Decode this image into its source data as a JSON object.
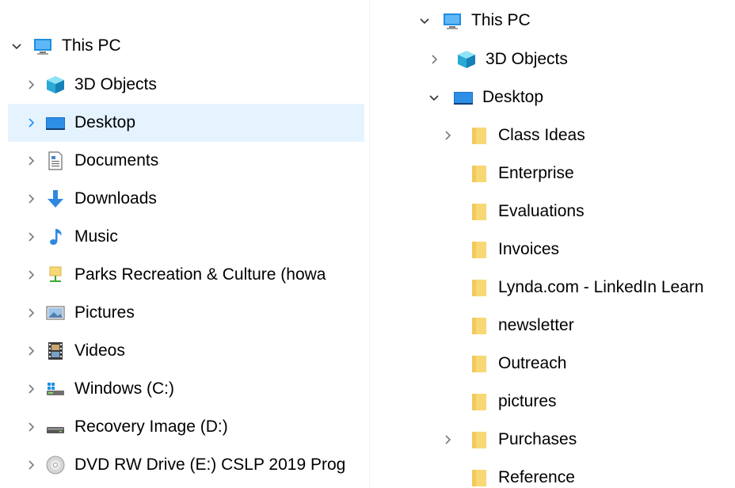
{
  "left_pane": {
    "items": [
      {
        "label": "This PC",
        "icon": "monitor-icon",
        "expander": "expanded",
        "selected": false
      },
      {
        "label": "3D Objects",
        "icon": "cube-3d-icon",
        "expander": "collapsed",
        "selected": false
      },
      {
        "label": "Desktop",
        "icon": "desktop-icon",
        "expander": "collapsed",
        "selected": true
      },
      {
        "label": "Documents",
        "icon": "document-icon",
        "expander": "collapsed",
        "selected": false
      },
      {
        "label": "Downloads",
        "icon": "download-arrow-icon",
        "expander": "collapsed",
        "selected": false
      },
      {
        "label": "Music",
        "icon": "music-note-icon",
        "expander": "collapsed",
        "selected": false
      },
      {
        "label": "Parks Recreation & Culture (howa",
        "icon": "network-drive-icon",
        "expander": "collapsed",
        "selected": false
      },
      {
        "label": "Pictures",
        "icon": "pictures-icon",
        "expander": "collapsed",
        "selected": false
      },
      {
        "label": "Videos",
        "icon": "film-strip-icon",
        "expander": "collapsed",
        "selected": false
      },
      {
        "label": "Windows (C:)",
        "icon": "windows-drive-icon",
        "expander": "collapsed",
        "selected": false
      },
      {
        "label": "Recovery Image (D:)",
        "icon": "hard-drive-icon",
        "expander": "collapsed",
        "selected": false
      },
      {
        "label": "DVD RW Drive (E:) CSLP 2019 Prog",
        "icon": "dvd-disc-icon",
        "expander": "collapsed",
        "selected": false
      }
    ]
  },
  "right_pane": {
    "items": [
      {
        "label": "This PC",
        "icon": "monitor-icon",
        "expander": "expanded"
      },
      {
        "label": "3D Objects",
        "icon": "cube-3d-icon",
        "expander": "collapsed"
      },
      {
        "label": "Desktop",
        "icon": "desktop-icon",
        "expander": "expanded"
      },
      {
        "label": "Class Ideas",
        "icon": "folder-icon",
        "expander": "collapsed"
      },
      {
        "label": "Enterprise",
        "icon": "folder-icon",
        "expander": "none"
      },
      {
        "label": "Evaluations",
        "icon": "folder-icon",
        "expander": "none"
      },
      {
        "label": "Invoices",
        "icon": "folder-icon",
        "expander": "none"
      },
      {
        "label": "Lynda.com - LinkedIn Learn",
        "icon": "folder-icon",
        "expander": "none"
      },
      {
        "label": "newsletter",
        "icon": "folder-icon",
        "expander": "none"
      },
      {
        "label": "Outreach",
        "icon": "folder-icon",
        "expander": "none"
      },
      {
        "label": "pictures",
        "icon": "folder-icon",
        "expander": "none"
      },
      {
        "label": "Purchases",
        "icon": "folder-icon",
        "expander": "collapsed"
      },
      {
        "label": "Reference",
        "icon": "folder-icon",
        "expander": "none"
      }
    ]
  },
  "colors": {
    "selection_bg": "#e5f3ff",
    "chevron": "#7a7a7a",
    "chevron_selected": "#1e90ff",
    "folder": "#f8d775"
  }
}
